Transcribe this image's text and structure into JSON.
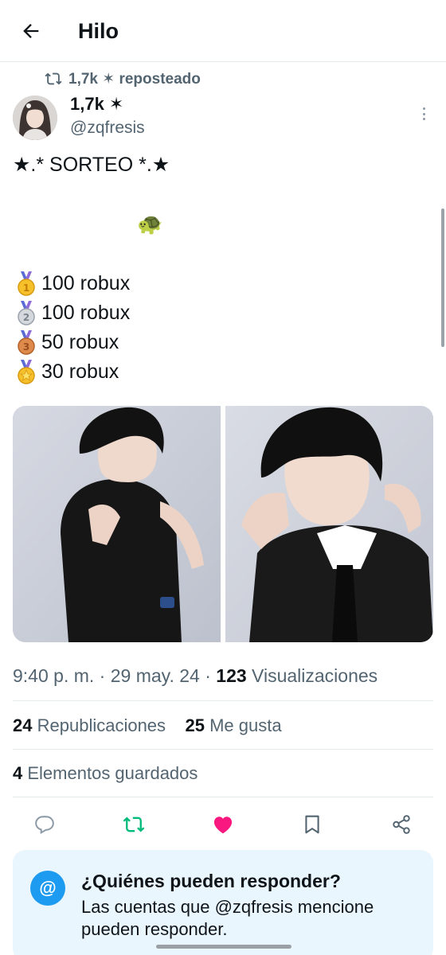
{
  "header": {
    "title": "Hilo",
    "back_icon": "arrow-left-icon"
  },
  "repost": {
    "text": "1,7k ✶ reposteado",
    "icon": "repost-icon"
  },
  "author": {
    "name": "1,7k ✶",
    "handle": "@zqfresis"
  },
  "tweet": {
    "line1": "★.* SORTEO *.★",
    "emoji": "🐢",
    "prizes": [
      {
        "medal": "gold-medal-1",
        "label": "100 robux"
      },
      {
        "medal": "silver-medal-2",
        "label": "100 robux"
      },
      {
        "medal": "bronze-medal-3",
        "label": " 50 robux"
      },
      {
        "medal": "star-medal",
        "label": " 30 robux"
      }
    ]
  },
  "meta": {
    "time": "9:40 p. m.",
    "sep": "·",
    "date": "29 may. 24",
    "views_count": "123",
    "views_label": "Visualizaciones"
  },
  "stats": {
    "reposts_count": "24",
    "reposts_label": "Republicaciones",
    "likes_count": "25",
    "likes_label": "Me gusta",
    "saves_count": "4",
    "saves_label": "Elementos guardados"
  },
  "actions": {
    "reply_icon": "reply-icon",
    "repost_icon": "repost-icon",
    "like_icon": "heart-icon",
    "bookmark_icon": "bookmark-icon",
    "share_icon": "share-icon",
    "repost_color": "#00ba7c",
    "like_color": "#f91880"
  },
  "reply_notice": {
    "icon_text": "@",
    "title": "¿Quiénes pueden responder?",
    "description": "Las cuentas que @zqfresis mencione pueden responder."
  },
  "colors": {
    "accent": "#1d9bf0",
    "secondary_text": "#536471",
    "notice_bg": "#eaf6fd"
  }
}
